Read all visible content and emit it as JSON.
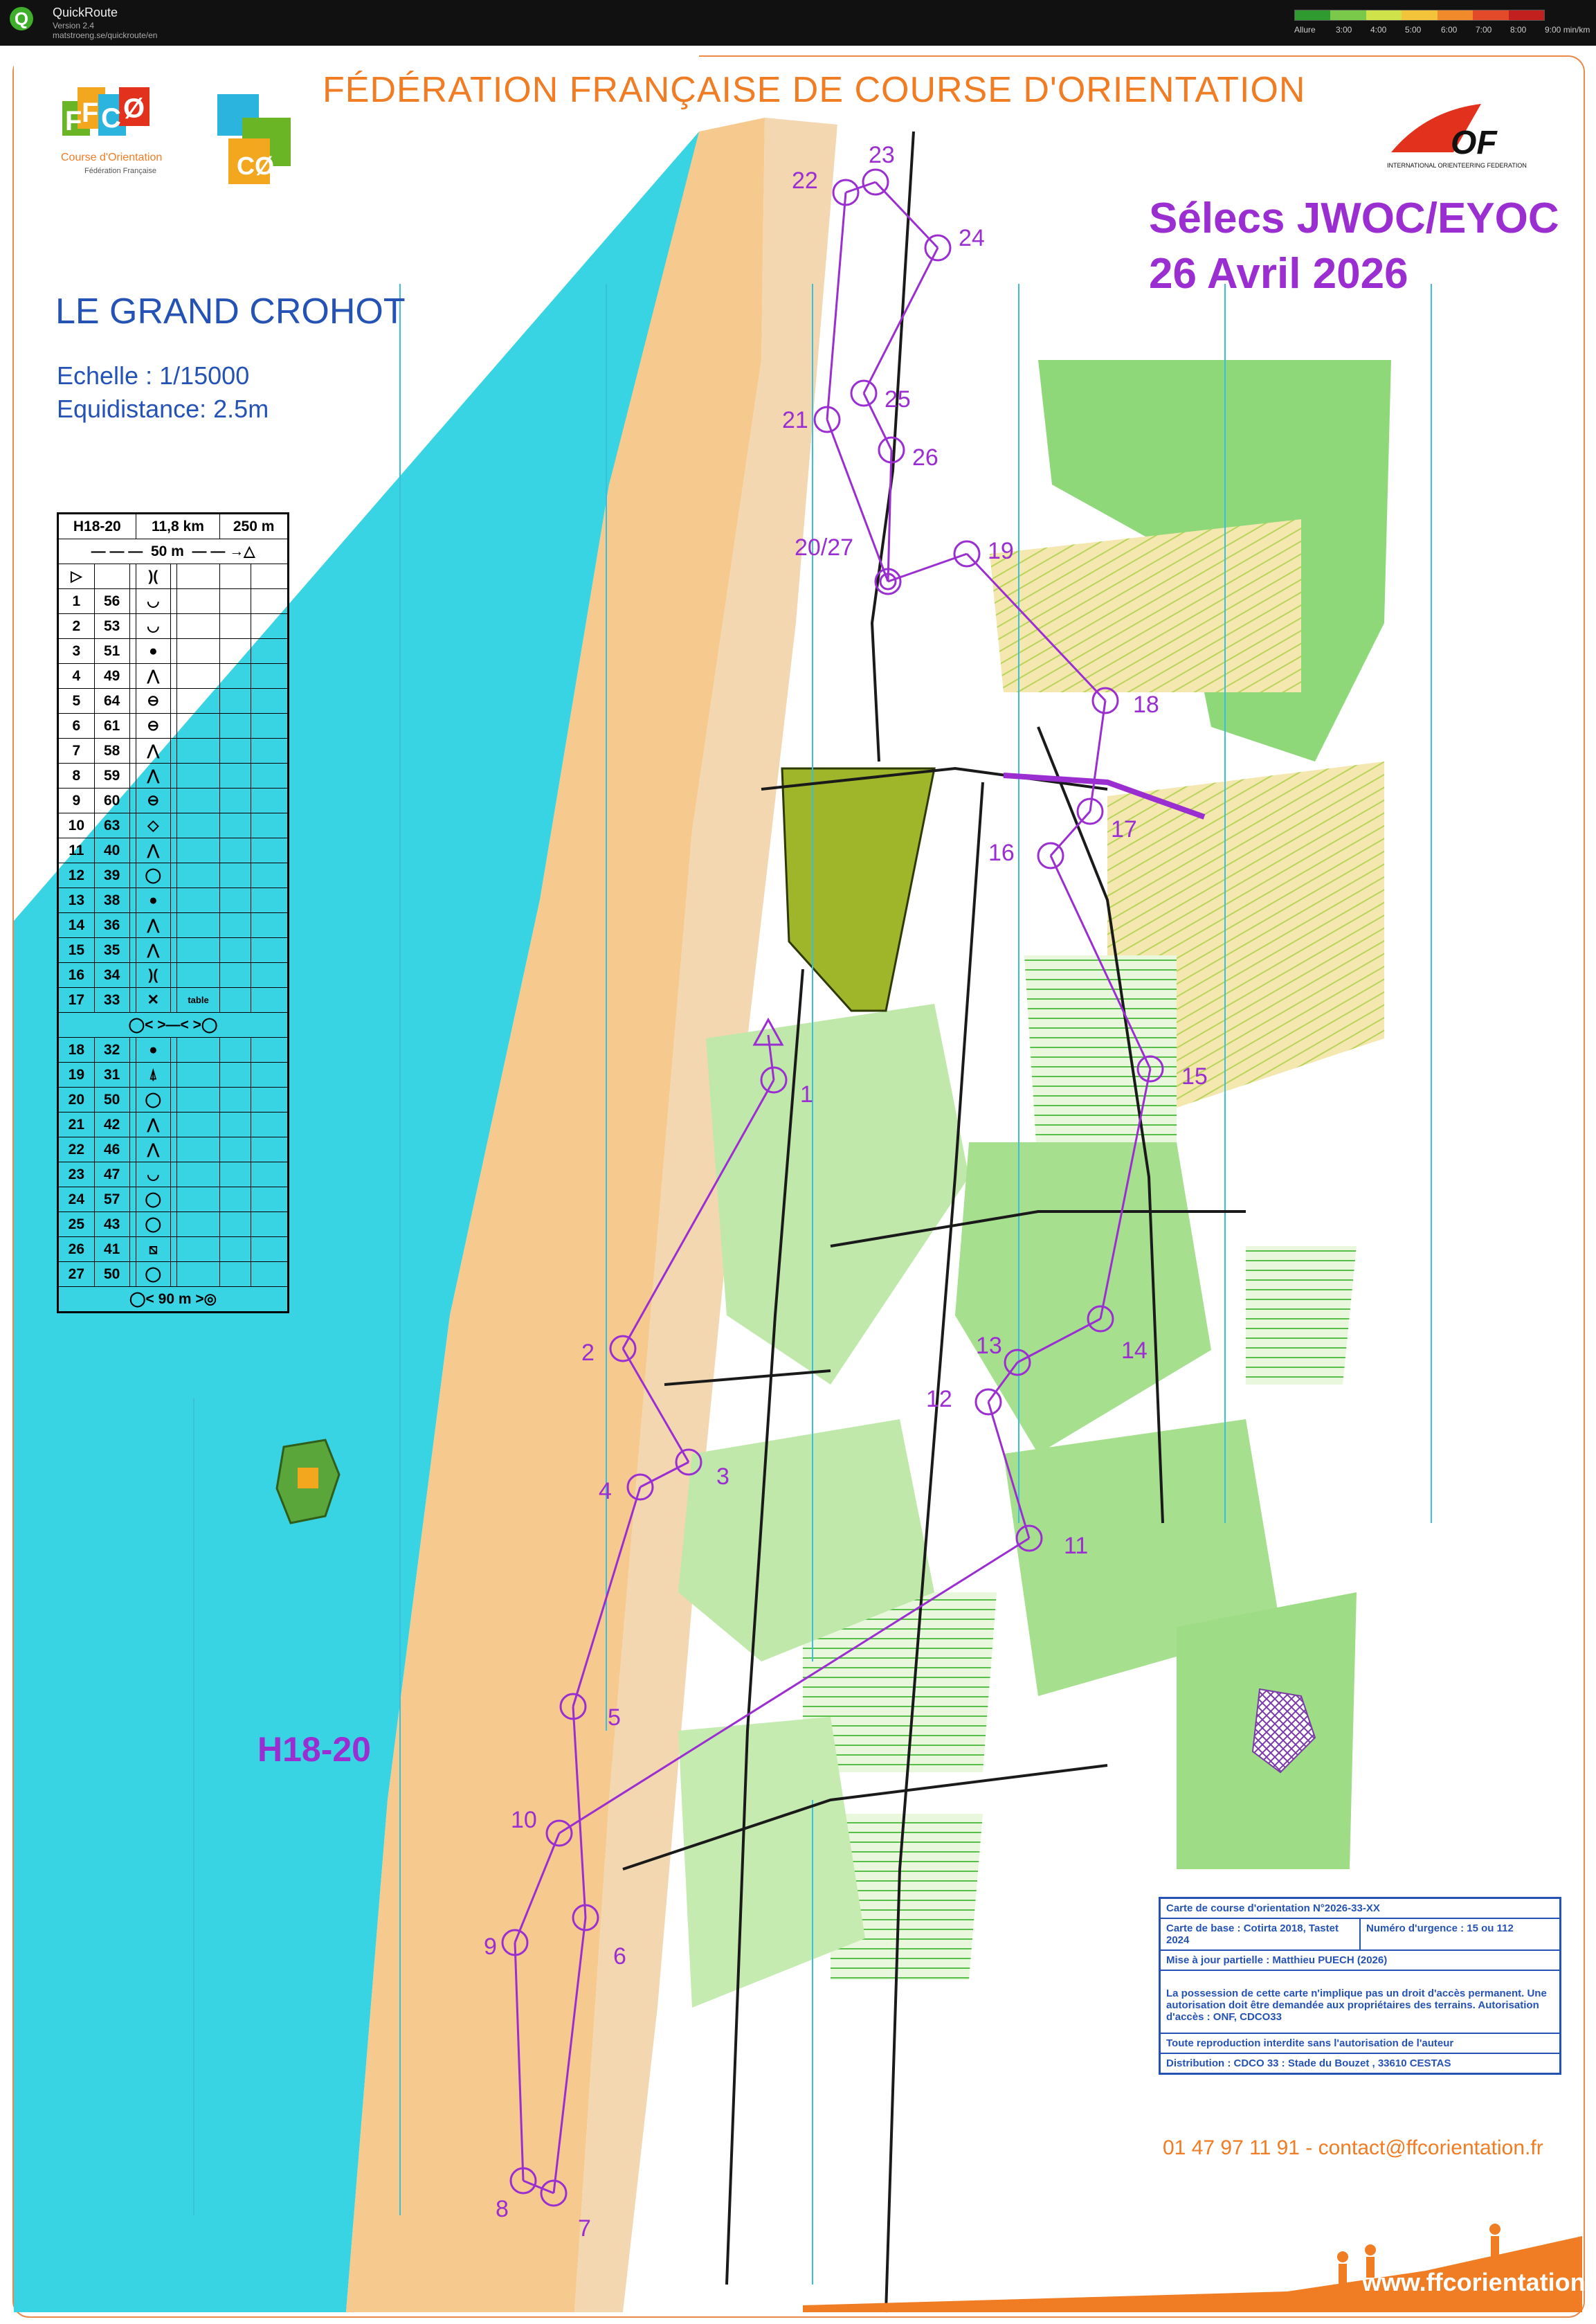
{
  "app": {
    "name": "QuickRoute",
    "version": "Version 2.4",
    "url": "matstroeng.se/quickroute/en"
  },
  "pace_legend": {
    "label": "Allure",
    "ticks": [
      "3:00",
      "4:00",
      "5:00",
      "6:00",
      "7:00",
      "8:00",
      "9:00 min/km"
    ],
    "colors": [
      "#2f9a2f",
      "#7ac94a",
      "#cfe24a",
      "#f3c33a",
      "#f08a2a",
      "#e24a2a",
      "#c21f1f"
    ]
  },
  "header": {
    "federation": "FÉDÉRATION FRANÇAISE DE COURSE D'ORIENTATION",
    "ffco_tagline": "Course d'Orientation",
    "ffco_sub": "Fédération Française",
    "iof_name": "INTERNATIONAL ORIENTEERING FEDERATION"
  },
  "map_title": "LE GRAND CROHOT",
  "scale": "Echelle : 1/15000",
  "equidistance": "Equidistance: 2.5m",
  "event": {
    "title": "Sélecs JWOC/EYOC",
    "date": "26 Avril 2026"
  },
  "course_label": "H18-20",
  "descriptions": {
    "header": [
      "H18-20",
      "11,8 km",
      "250 m"
    ],
    "start_marking": "50 m",
    "mid_marking": "",
    "finish_marking": "90 m",
    "controls": [
      {
        "n": "1",
        "code": "56"
      },
      {
        "n": "2",
        "code": "53"
      },
      {
        "n": "3",
        "code": "51"
      },
      {
        "n": "4",
        "code": "49"
      },
      {
        "n": "5",
        "code": "64"
      },
      {
        "n": "6",
        "code": "61"
      },
      {
        "n": "7",
        "code": "58"
      },
      {
        "n": "8",
        "code": "59"
      },
      {
        "n": "9",
        "code": "60"
      },
      {
        "n": "10",
        "code": "63"
      },
      {
        "n": "11",
        "code": "40"
      },
      {
        "n": "12",
        "code": "39"
      },
      {
        "n": "13",
        "code": "38"
      },
      {
        "n": "14",
        "code": "36"
      },
      {
        "n": "15",
        "code": "35"
      },
      {
        "n": "16",
        "code": "34"
      },
      {
        "n": "17",
        "code": "33",
        "note": "table"
      },
      {
        "n": "18",
        "code": "32"
      },
      {
        "n": "19",
        "code": "31"
      },
      {
        "n": "20",
        "code": "50"
      },
      {
        "n": "21",
        "code": "42"
      },
      {
        "n": "22",
        "code": "46"
      },
      {
        "n": "23",
        "code": "47"
      },
      {
        "n": "24",
        "code": "57"
      },
      {
        "n": "25",
        "code": "43"
      },
      {
        "n": "26",
        "code": "41"
      },
      {
        "n": "27",
        "code": "50"
      }
    ]
  },
  "controls_on_map": [
    "1",
    "2",
    "3",
    "4",
    "5",
    "6",
    "7",
    "8",
    "9",
    "10",
    "11",
    "12",
    "13",
    "14",
    "15",
    "16",
    "17",
    "18",
    "19",
    "20/27",
    "21",
    "22",
    "23",
    "24",
    "25",
    "26"
  ],
  "info_box": {
    "line1": "Carte de course d'orientation N°2026-33-XX",
    "line2a": "Carte de base : Cotirta 2018, Tastet 2024",
    "line2b": "Numéro d'urgence : 15 ou 112",
    "line3": "Mise à jour partielle : Matthieu PUECH (2026)",
    "line4": "La possession de cette carte n'implique pas un droit d'accès permanent. Une autorisation doit être demandée aux propriétaires des terrains. Autorisation d'accès : ONF, CDCO33",
    "line5": "Toute reproduction interdite sans l'autorisation de l'auteur",
    "line6": "Distribution : CDCO 33 : Stade du Bouzet , 33610 CESTAS"
  },
  "contact": "01 47 97 11 91 - contact@ffcorientation.fr",
  "website": "www.ffcorientation.fr",
  "colors": {
    "course": "#9b2ed1",
    "ffco_orange": "#f07c24",
    "title_blue": "#2553b5",
    "sea": "#39d4e3",
    "sand": "#f6c98e",
    "forest_green": "#7dd16a",
    "open_yellow": "#f2d88a"
  }
}
